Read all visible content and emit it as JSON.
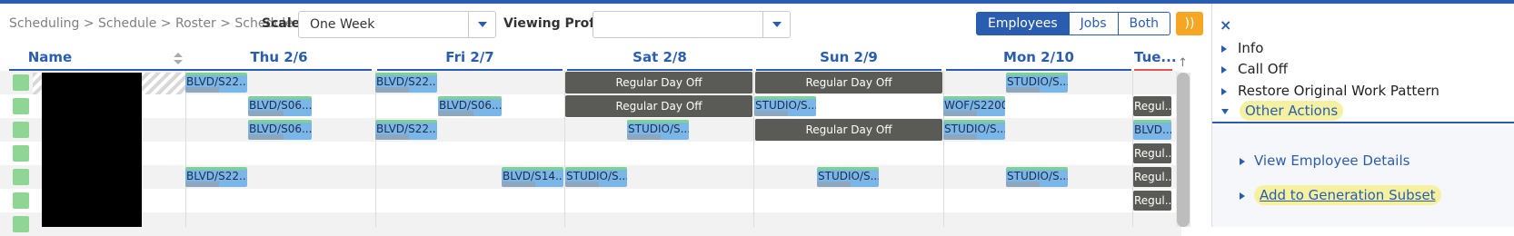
{
  "breadcrumb": "Scheduling > Schedule > Roster > Schedule",
  "scale": {
    "label": "Scale",
    "value": "One Week"
  },
  "viewing_profile": {
    "label": "Viewing Profile",
    "value": ""
  },
  "view_toggle": [
    "Employees",
    "Jobs",
    "Both"
  ],
  "view_toggle_selected": "Employees",
  "orange_button_icon": "speaker-icon",
  "grid": {
    "name_header": "Name",
    "days": [
      "Thu 2/6",
      "Fri 2/7",
      "Sat 2/8",
      "Sun 2/9",
      "Mon 2/10",
      "Tue..."
    ],
    "cells": {
      "r0_thu": "BLVD/S22...",
      "r0_fri": "BLVD/S22...",
      "r0_sat": "Regular Day Off",
      "r0_sun": "Regular Day Off",
      "r0_mon": "STUDIO/S...",
      "r1_thu": "BLVD/S06...",
      "r1_fri": "BLVD/S06...",
      "r1_sat": "Regular Day Off",
      "r1_sun": "STUDIO/S...",
      "r1_mon": "WOF/S2200",
      "r1_tue": "Regul...",
      "r2_thu": "BLVD/S06...",
      "r2_fri": "BLVD/S22...",
      "r2_sat": "STUDIO/S...",
      "r2_sun": "Regular Day Off",
      "r2_mon": "STUDIO/S...",
      "r2_tue": "BLVD...",
      "r3_tue": "Regul...",
      "r4_thu": "BLVD/S22...",
      "r4_fri": "BLVD/S14...",
      "r4_sat": "STUDIO/S...",
      "r4_sun": "STUDIO/S...",
      "r4_mon": "STUDIO/S...",
      "r4_tue": "Regul...",
      "r5_tue": "Regul..."
    }
  },
  "panel": {
    "close_icon": "×",
    "items": [
      "Info",
      "Call Off",
      "Restore Original Work Pattern",
      "Other Actions"
    ],
    "sub_links": [
      "View Employee Details",
      "Add to Generation Subset"
    ]
  },
  "colors": {
    "accent": "#2a5db0",
    "day_off": "#5a5a56",
    "shift_blue": "#7ab6e8",
    "shift_green": "#7ed38f",
    "highlight": "#f6f1a0",
    "orange": "#f5a623"
  }
}
